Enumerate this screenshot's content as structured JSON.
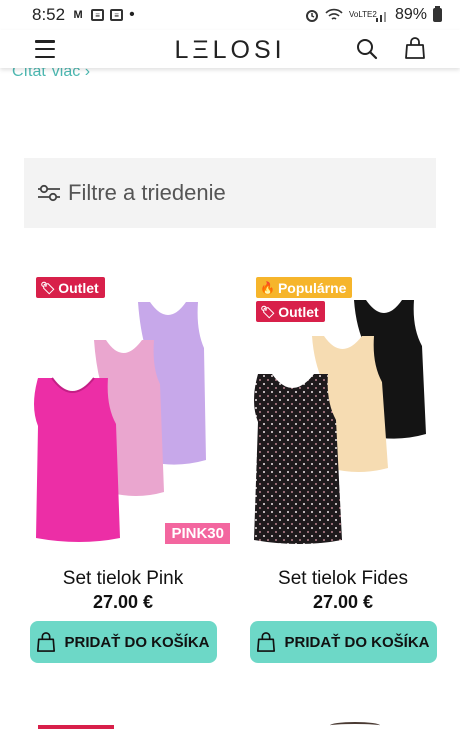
{
  "status_bar": {
    "time": "8:52",
    "notif_icons": [
      "gmail-icon",
      "messages-icon",
      "messages-icon"
    ],
    "dot": "•",
    "network": "VoLTE2",
    "battery_percent": "89%"
  },
  "header": {
    "logo": "LΞLOSI"
  },
  "read_more": "Čítať viac ›",
  "filter": {
    "label": "Filtre a triedenie"
  },
  "products": [
    {
      "badges": [
        {
          "label": "Outlet",
          "type": "outlet"
        }
      ],
      "promo_code": "PINK30",
      "title": "Set tielok Pink",
      "price": "27.00 €",
      "button_label": "PRIDAŤ DO KOŠÍKA"
    },
    {
      "badges": [
        {
          "label": "Populárne",
          "type": "popular"
        },
        {
          "label": "Outlet",
          "type": "outlet"
        }
      ],
      "title": "Set tielok Fides",
      "price": "27.00 €",
      "button_label": "PRIDAŤ DO KOŠÍKA"
    }
  ],
  "colors": {
    "accent_teal": "#6dd8c7",
    "link_teal": "#4cb8b1",
    "outlet_red": "#d8204a",
    "popular_orange": "#f6b52b",
    "promo_pink": "#f3669f"
  }
}
